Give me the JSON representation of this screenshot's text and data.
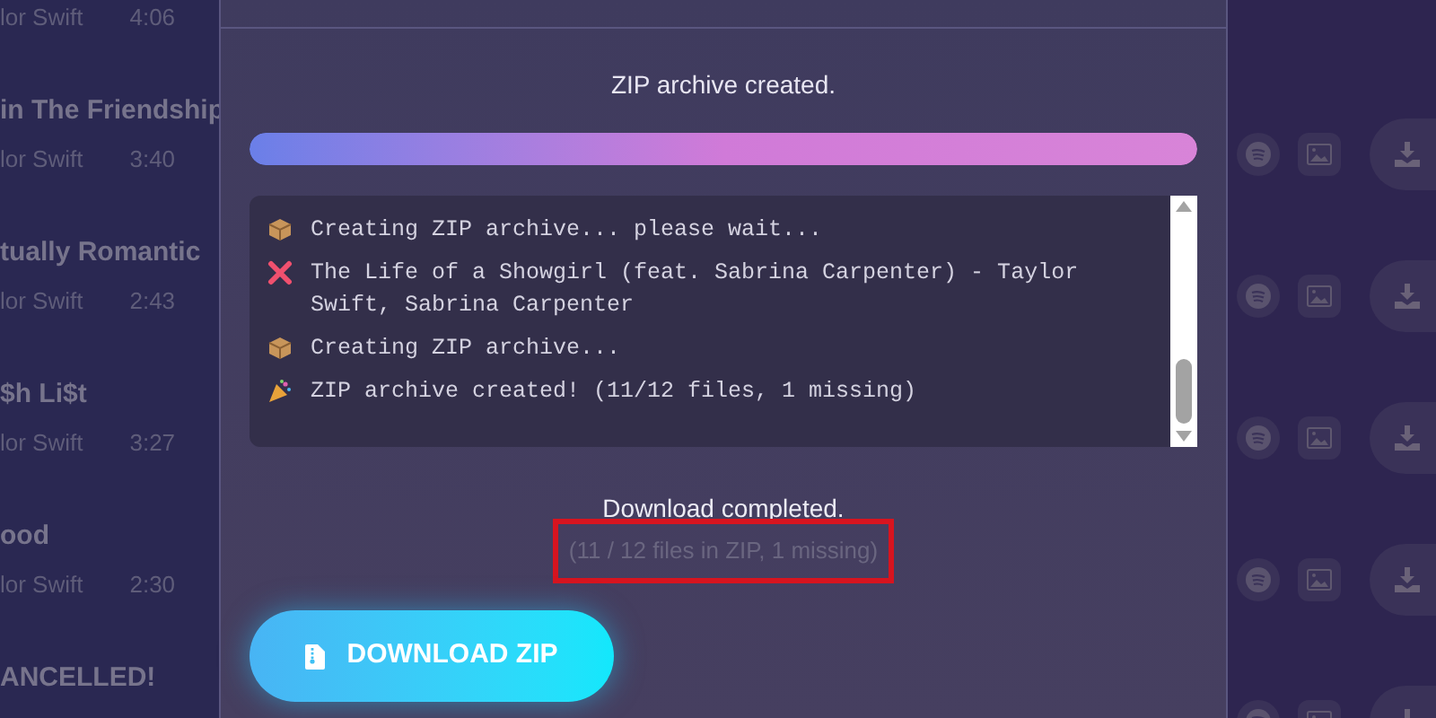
{
  "tracks": [
    {
      "artist": "lor Swift",
      "duration": "4:06"
    },
    {
      "title": "in The Friendship",
      "artist": "lor Swift",
      "duration": "3:40"
    },
    {
      "title": "tually Romantic",
      "artist": "lor Swift",
      "duration": "2:43"
    },
    {
      "title": "$h Li$t",
      "artist": "lor Swift",
      "duration": "3:27"
    },
    {
      "title": "ood",
      "artist": "lor Swift",
      "duration": "2:30"
    },
    {
      "title": "ANCELLED!"
    }
  ],
  "dialog": {
    "status": "ZIP archive created.",
    "progress": {
      "level": 1
    },
    "log": [
      {
        "kind": "package",
        "text": "Creating ZIP archive... please wait..."
      },
      {
        "kind": "error",
        "text": "The Life of a Showgirl (feat. Sabrina Carpenter) - Taylor Swift, Sabrina Carpenter"
      },
      {
        "kind": "package",
        "text": "Creating ZIP archive..."
      },
      {
        "kind": "party",
        "text": "ZIP archive created! (11/12 files, 1 missing)"
      }
    ],
    "result": "Download completed.",
    "summary": "(11 / 12 files in ZIP, 1 missing)",
    "summary_highlighted": true,
    "button": "DOWNLOAD ZIP"
  }
}
